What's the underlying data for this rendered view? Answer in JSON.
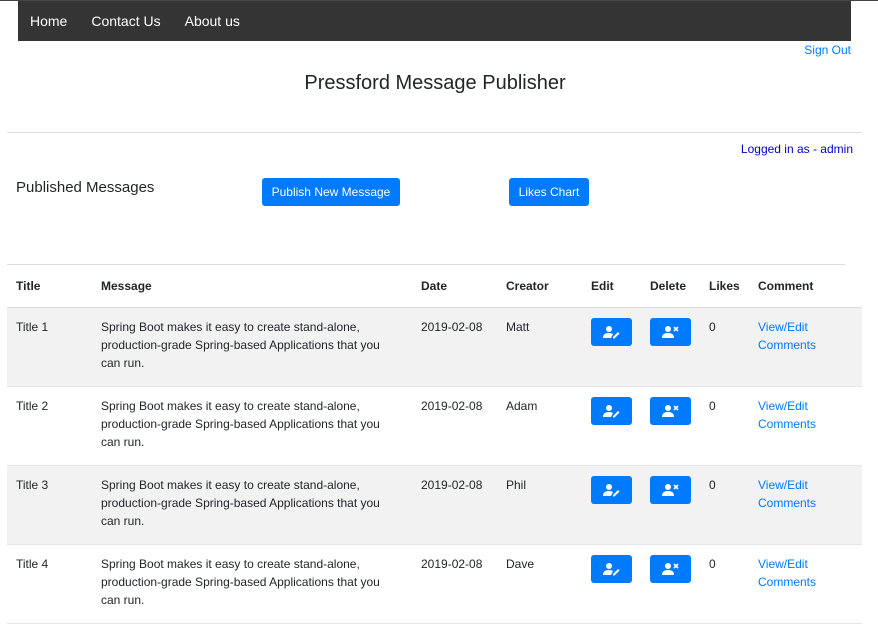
{
  "nav": {
    "items": [
      {
        "label": "Home"
      },
      {
        "label": "Contact Us"
      },
      {
        "label": "About us"
      }
    ],
    "sign_out": "Sign Out"
  },
  "page": {
    "title": "Pressford Message Publisher",
    "logged_in": "Logged in as - admin",
    "section_title": "Published Messages",
    "publish_button": "Publish New Message",
    "likes_chart_button": "Likes Chart"
  },
  "table": {
    "headers": {
      "title": "Title",
      "message": "Message",
      "date": "Date",
      "creator": "Creator",
      "edit": "Edit",
      "delete": "Delete",
      "likes": "Likes",
      "comment": "Comment"
    },
    "rows": [
      {
        "title": "Title 1",
        "message": "Spring Boot makes it easy to create stand-alone, production-grade Spring-based Applications that you can run.",
        "date": "2019-02-08",
        "creator": "Matt",
        "likes": "0",
        "comment_link": "View/Edit Comments"
      },
      {
        "title": "Title 2",
        "message": "Spring Boot makes it easy to create stand-alone, production-grade Spring-based Applications that you can run.",
        "date": "2019-02-08",
        "creator": "Adam",
        "likes": "0",
        "comment_link": "View/Edit Comments"
      },
      {
        "title": "Title 3",
        "message": "Spring Boot makes it easy to create stand-alone, production-grade Spring-based Applications that you can run.",
        "date": "2019-02-08",
        "creator": "Phil",
        "likes": "0",
        "comment_link": "View/Edit Comments"
      },
      {
        "title": "Title 4",
        "message": "Spring Boot makes it easy to create stand-alone, production-grade Spring-based Applications that you can run.",
        "date": "2019-02-08",
        "creator": "Dave",
        "likes": "0",
        "comment_link": "View/Edit Comments"
      }
    ]
  },
  "icons": {
    "edit": "user-edit-icon",
    "delete": "user-remove-icon"
  },
  "colors": {
    "navbar": "#343434",
    "primary": "#007bff",
    "row_stripe": "#f2f2f2",
    "logged_in_text": "#0000cc"
  }
}
